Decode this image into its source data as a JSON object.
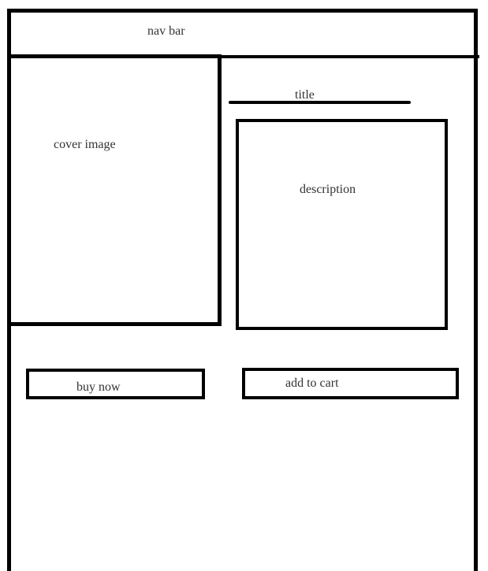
{
  "nav": {
    "label": "nav bar"
  },
  "cover": {
    "label": "cover image"
  },
  "product": {
    "title_label": "title",
    "description_label": "description"
  },
  "actions": {
    "buy_now": "buy now",
    "add_to_cart": "add to cart"
  },
  "colors": {
    "stroke": "#000000",
    "text": "#333333",
    "background": "#ffffff"
  }
}
